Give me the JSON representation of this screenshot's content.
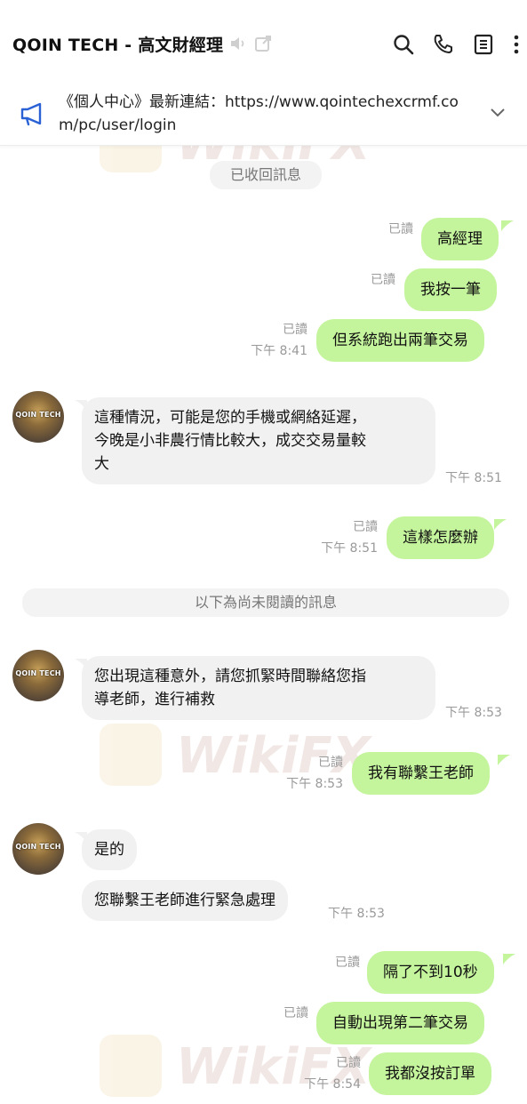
{
  "header": {
    "title": "QOIN TECH - 高文財經理",
    "icons": [
      "mute-icon",
      "external-window-icon",
      "search-icon",
      "phone-icon",
      "notes-icon",
      "more-icon"
    ]
  },
  "announcement": {
    "text": "《個人中心》最新連結：https://www.qointechexcrmf.com/pc/user/login"
  },
  "watermark": {
    "text": "WikiFX"
  },
  "chat": {
    "recalled_notice": "已收回訊息",
    "unread_divider": "以下為尚未閱讀的訊息",
    "avatar_label": "QOIN TECH",
    "read_label": "已讀",
    "messages": [
      {
        "dir": "out",
        "text": "高經理",
        "read": "已讀",
        "time": ""
      },
      {
        "dir": "out",
        "text": "我按一筆",
        "read": "已讀",
        "time": ""
      },
      {
        "dir": "out",
        "text": "但系統跑出兩筆交易",
        "read": "已讀",
        "time": "下午 8:41"
      },
      {
        "dir": "in",
        "text": "這種情況，可能是您的手機或網絡延遲，今晚是小非農行情比較大，成交交易量較大",
        "time": "下午 8:51"
      },
      {
        "dir": "out",
        "text": "這樣怎麼辦",
        "read": "已讀",
        "time": "下午 8:51"
      },
      {
        "dir": "in",
        "text": "您出現這種意外，請您抓緊時間聯絡您指導老師，進行補救",
        "time": "下午 8:53"
      },
      {
        "dir": "out",
        "text": "我有聯繫王老師",
        "read": "已讀",
        "time": "下午 8:53"
      },
      {
        "dir": "in",
        "text": "是的",
        "time": ""
      },
      {
        "dir": "in",
        "text": "您聯繫王老師進行緊急處理",
        "time": "下午 8:53"
      },
      {
        "dir": "out",
        "text": "隔了不到10秒",
        "read": "已讀",
        "time": ""
      },
      {
        "dir": "out",
        "text": "自動出現第二筆交易",
        "read": "已讀",
        "time": ""
      },
      {
        "dir": "out",
        "text": "我都沒按訂單",
        "read": "已讀",
        "time": "下午 8:54"
      }
    ],
    "in_lines": {
      "m3": [
        "這種情況，可能是您的手機或網絡延遲，",
        "今晚是小非農行情比較大，成交交易量較",
        "大"
      ],
      "m5": [
        "您出現這種意外，請您抓緊時間聯絡您指",
        "導老師，進行補救"
      ]
    }
  },
  "colors": {
    "outgoing_bubble": "#c4f49c",
    "incoming_bubble": "#f1f1f1",
    "meta_text": "#9a9a9a",
    "announce_icon": "#2a62d6"
  }
}
